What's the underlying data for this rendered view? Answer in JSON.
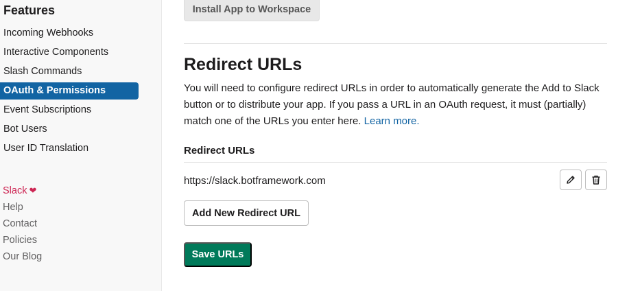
{
  "sidebar": {
    "heading": "Features",
    "items": [
      {
        "label": "Incoming Webhooks"
      },
      {
        "label": "Interactive Components"
      },
      {
        "label": "Slash Commands"
      },
      {
        "label": "OAuth & Permissions",
        "active": true
      },
      {
        "label": "Event Subscriptions"
      },
      {
        "label": "Bot Users"
      },
      {
        "label": "User ID Translation"
      }
    ],
    "footer": {
      "slack": "Slack",
      "help": "Help",
      "contact": "Contact",
      "policies": "Policies",
      "blog": "Our Blog"
    }
  },
  "main": {
    "install_button": "Install App to Workspace",
    "redirect": {
      "title": "Redirect URLs",
      "description": "You will need to configure redirect URLs in order to automatically generate the Add to Slack button or to distribute your app. If you pass a URL in an OAuth request, it must (partially) match one of the URLs you enter here.",
      "learn_more": "Learn more.",
      "list_title": "Redirect URLs",
      "urls": [
        "https://slack.botframework.com"
      ],
      "add_button": "Add New Redirect URL",
      "save_button": "Save URLs"
    }
  },
  "colors": {
    "active_nav": "#1264a3",
    "link": "#1264a3",
    "save_green": "#007a5a",
    "slack_red": "#cd2553"
  },
  "icons": [
    "heart-icon",
    "pencil-icon",
    "trash-icon"
  ]
}
